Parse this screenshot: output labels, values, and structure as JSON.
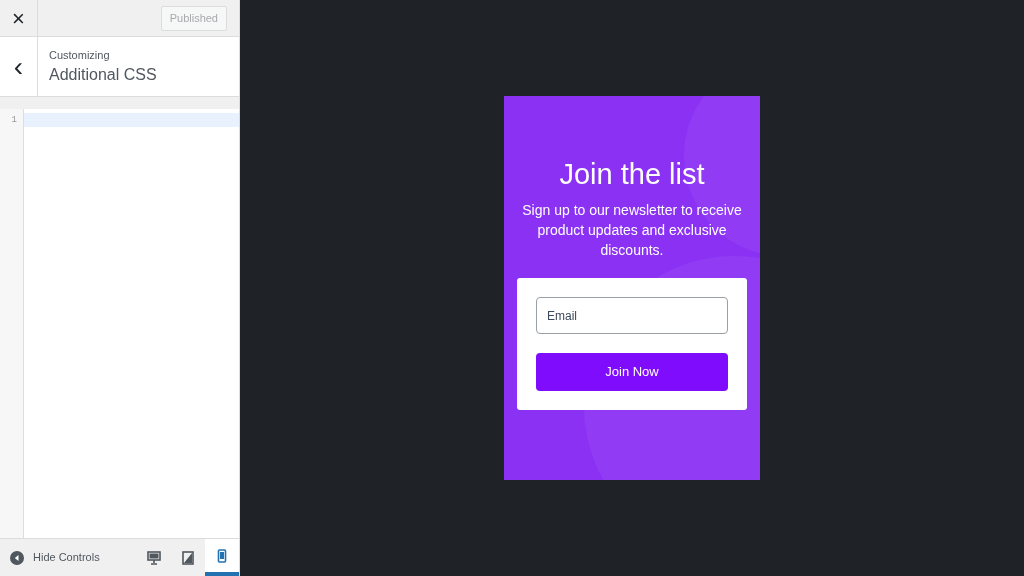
{
  "header": {
    "close": "×",
    "publish_button": {
      "label": "Published",
      "disabled": true
    }
  },
  "section": {
    "back": "‹",
    "breadcrumb": "Customizing",
    "title": "Additional CSS"
  },
  "editor": {
    "line_numbers": [
      "1"
    ]
  },
  "footer": {
    "hide_controls": "Hide Controls",
    "devices": [
      {
        "kind": "desktop",
        "selected": false
      },
      {
        "kind": "tablet",
        "selected": false
      },
      {
        "kind": "mobile",
        "selected": true
      }
    ]
  },
  "preview": {
    "title": "Join the list",
    "description": "Sign up to our newsletter to receive product updates and exclusive discounts.",
    "email_field": {
      "placeholder": "Email"
    },
    "submit_button": "Join Now"
  }
}
